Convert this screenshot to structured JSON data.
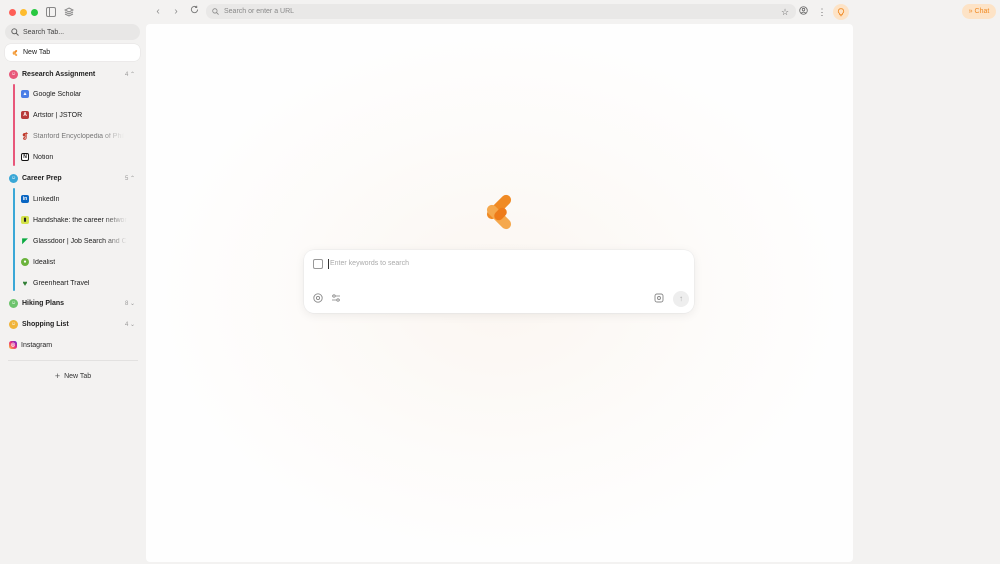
{
  "sidebar": {
    "search_placeholder": "Search Tab...",
    "current_tab": "New Tab",
    "groups": [
      {
        "name": "Research Assignment",
        "count": "4",
        "color": "#e8577a",
        "tabs": [
          {
            "label": "Google Scholar",
            "icon": "google-scholar-icon",
            "color": "#4a7ee6"
          },
          {
            "label": "Artstor | JSTOR",
            "icon": "jstor-icon",
            "color": "#b83a3a"
          },
          {
            "label": "Stanford Encyclopedia of Phil",
            "icon": "stanford-icon",
            "color": "#c0392b"
          },
          {
            "label": "Notion",
            "icon": "notion-icon",
            "color": "#111111"
          }
        ]
      },
      {
        "name": "Career Prep",
        "count": "5",
        "color": "#3aa7d6",
        "tabs": [
          {
            "label": "LinkedIn",
            "icon": "linkedin-icon",
            "color": "#0a66c2"
          },
          {
            "label": "Handshake: the career networ",
            "icon": "handshake-icon",
            "color": "#d4e34a"
          },
          {
            "label": "Glassdoor | Job Search and C",
            "icon": "glassdoor-icon",
            "color": "#0caa41"
          },
          {
            "label": "Idealist",
            "icon": "idealist-icon",
            "color": "#6bb33c"
          },
          {
            "label": "Greenheart Travel",
            "icon": "greenheart-icon",
            "color": "#2e7d32"
          }
        ]
      },
      {
        "name": "Hiking Plans",
        "count": "8",
        "color": "#6cc36c"
      },
      {
        "name": "Shopping List",
        "count": "4",
        "color": "#f0b43a"
      }
    ],
    "pinned": {
      "label": "Instagram",
      "icon": "instagram-icon"
    },
    "new_tab_label": "New Tab"
  },
  "toolbar": {
    "url_placeholder": "Search or enter a URL",
    "chat_label": "Chat"
  },
  "main": {
    "search_placeholder": "Enter keywords to search"
  },
  "colors": {
    "accent": "#f08a24",
    "accent_bg": "#fde3c6"
  }
}
